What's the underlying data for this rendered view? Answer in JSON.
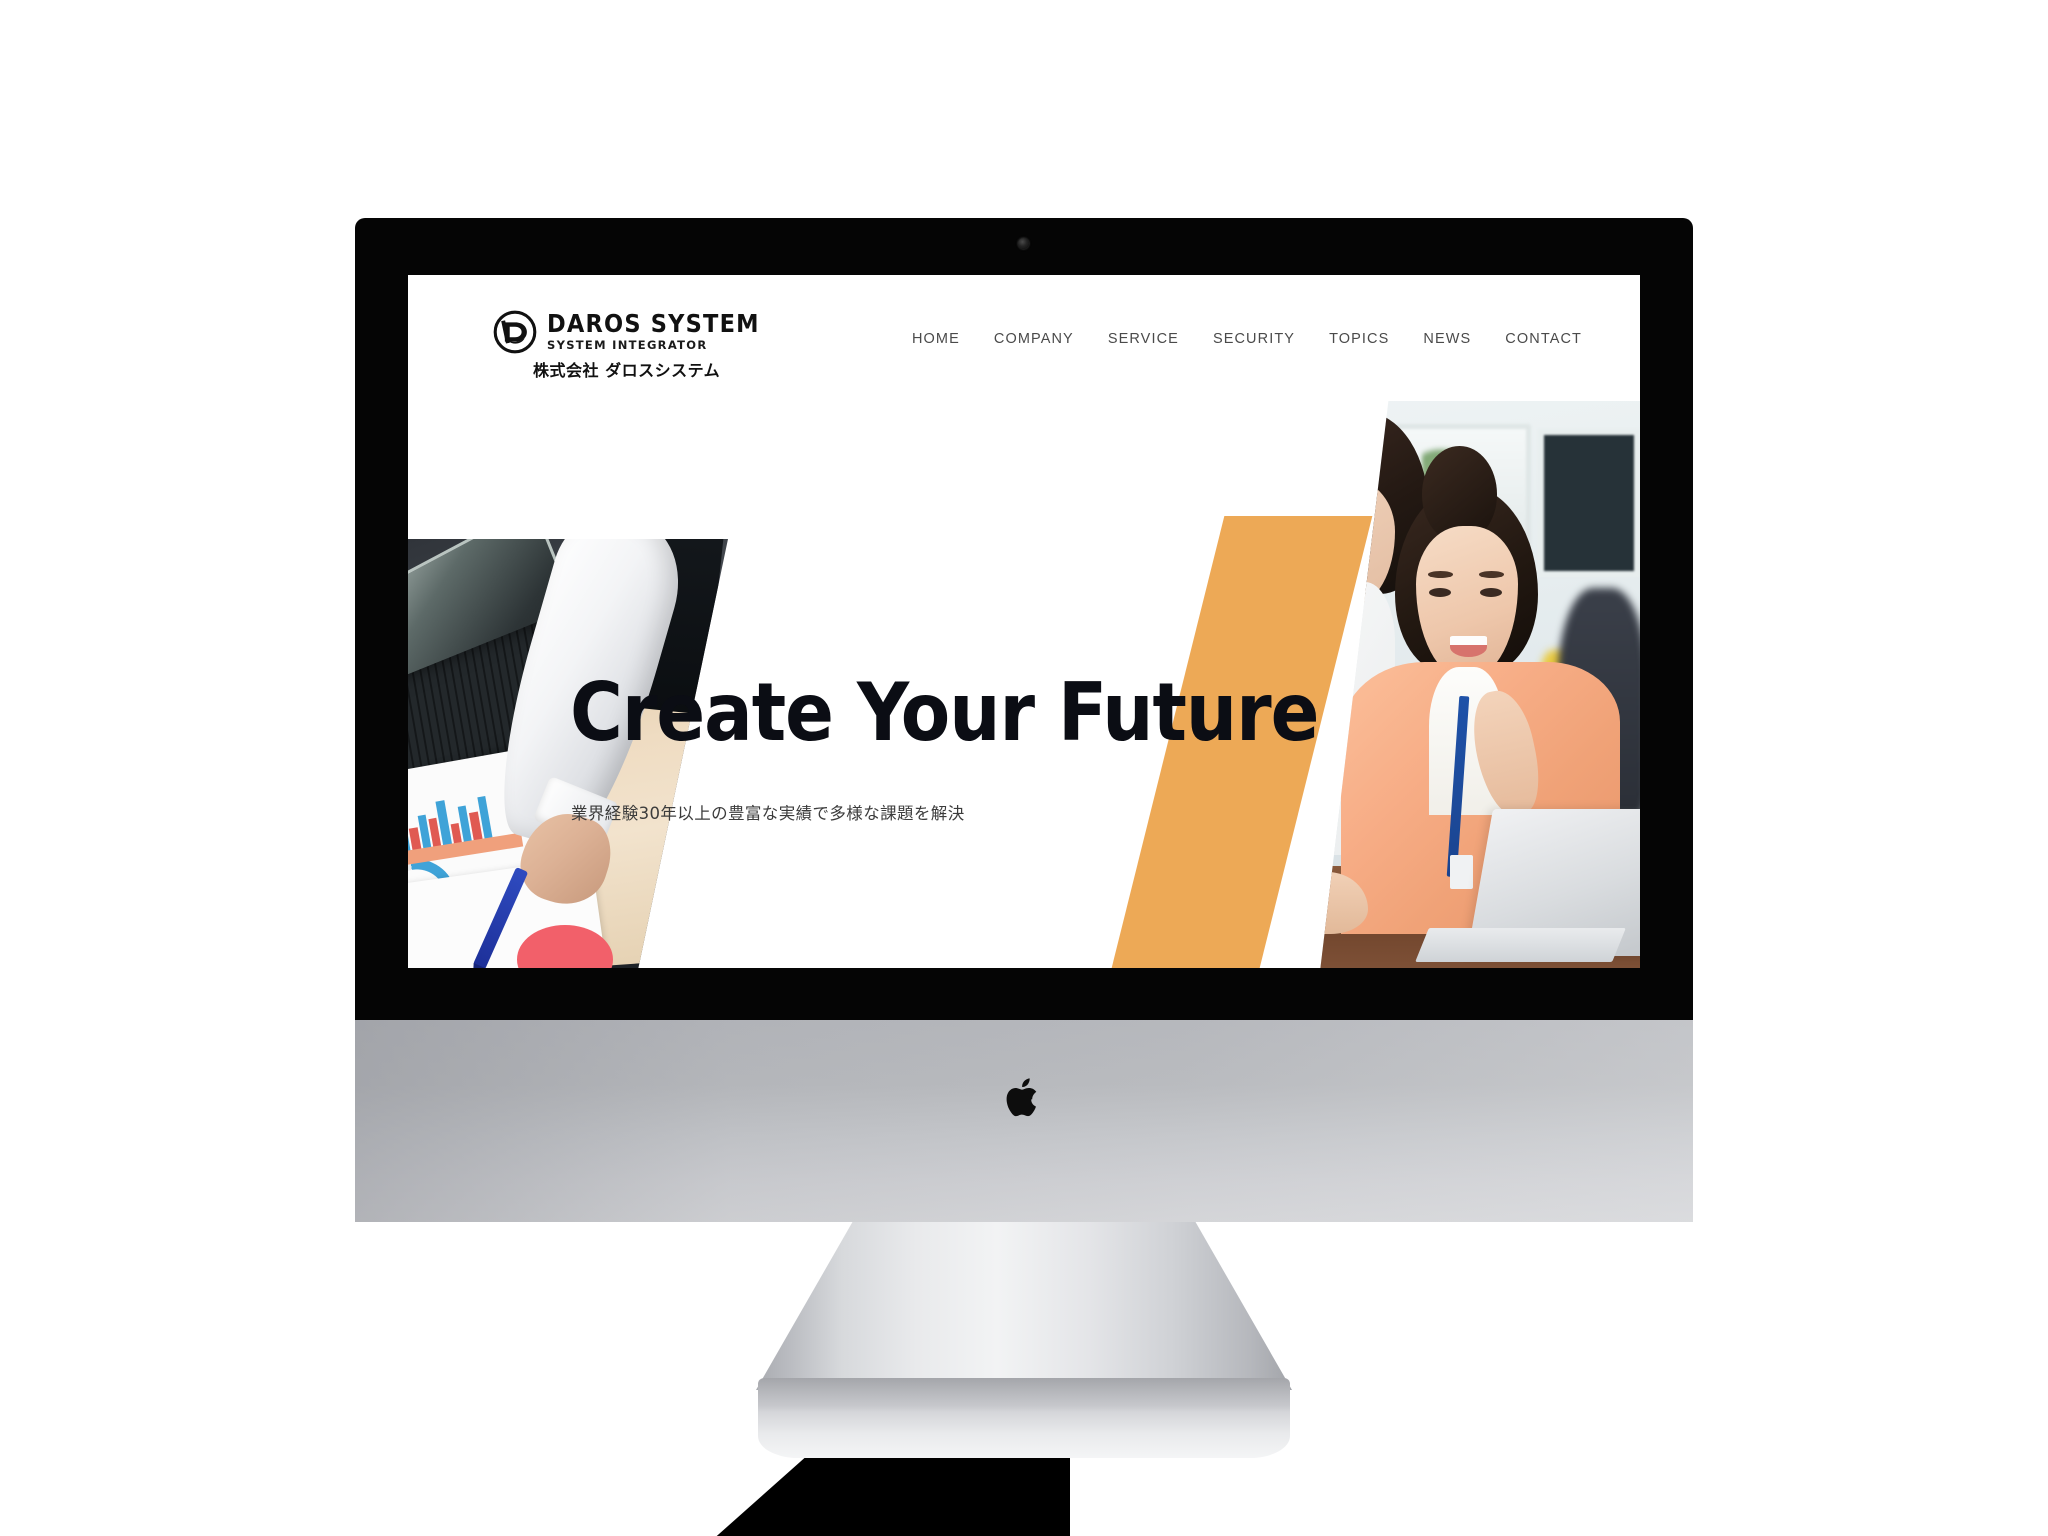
{
  "device": {
    "type": "imac-desktop-mockup",
    "brand_icon": "apple-logo",
    "camera_icon": "camera-dot-icon"
  },
  "site": {
    "header": {
      "logo": {
        "mark_icon": "daros-d-monogram-icon",
        "title": "DAROS SYSTEM",
        "tagline": "SYSTEM INTEGRATOR",
        "company_jp": "株式会社 ダロスシステム"
      },
      "nav": [
        {
          "label": "HOME"
        },
        {
          "label": "COMPANY"
        },
        {
          "label": "SERVICE"
        },
        {
          "label": "SECURITY"
        },
        {
          "label": "TOPICS"
        },
        {
          "label": "NEWS"
        },
        {
          "label": "CONTACT"
        }
      ]
    },
    "hero": {
      "headline": "Create Your Future",
      "subcopy": "業界経験30年以上の豊富な実績で多様な課題を解決",
      "left_photo_alt": "デスクの資料を指し示すビジネスパーソン",
      "right_photo_alt": "ノートパソコンを見て笑顔の女性社員二人",
      "accent_shape": "orange-parallelogram"
    }
  },
  "colors": {
    "accent_orange": "#eb9d3f",
    "headline": "#0b0d14",
    "nav_text": "#4a4a4a",
    "page_background": "#ffffff",
    "bezel": "#050505",
    "chin_silver": "#c3c5c9"
  }
}
